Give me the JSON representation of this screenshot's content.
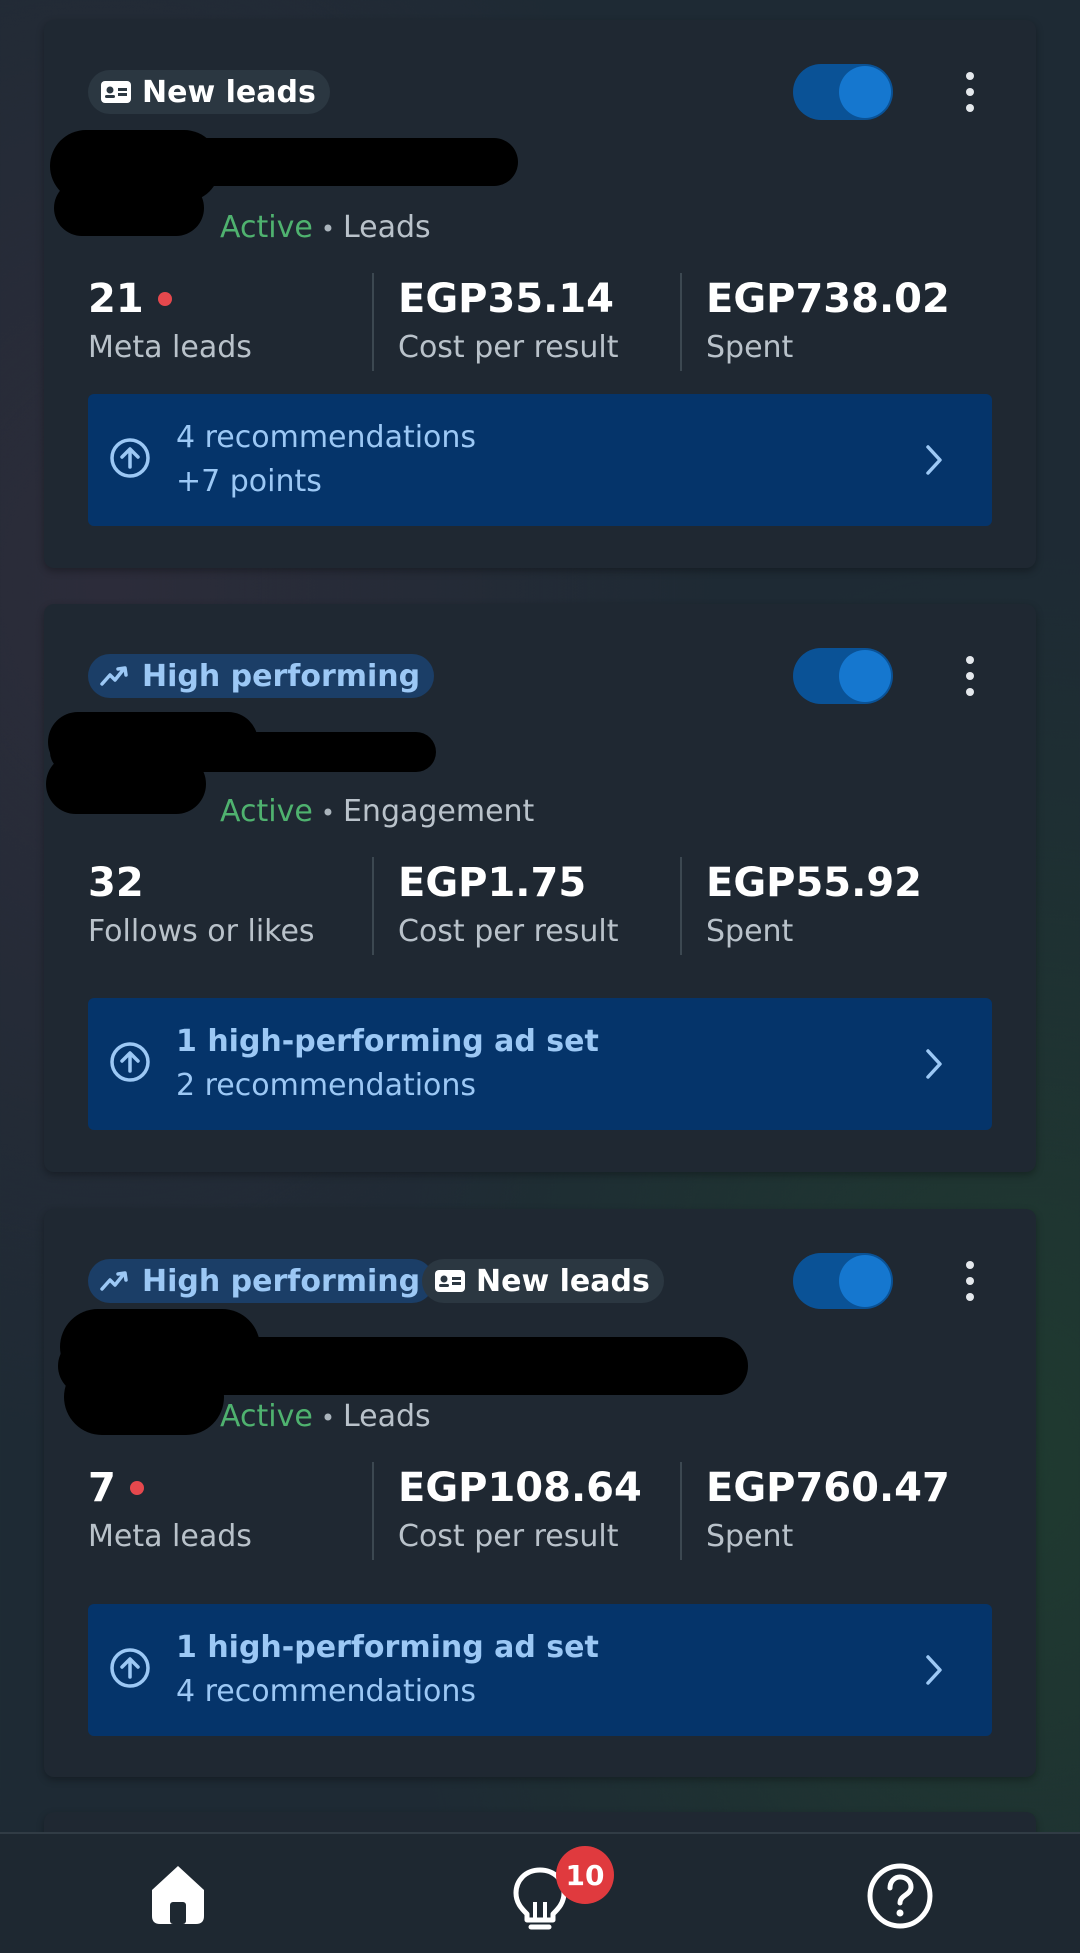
{
  "campaigns": [
    {
      "chips": [
        {
          "type": "leads",
          "label": "New leads"
        }
      ],
      "status": "Active",
      "objective": "Leads",
      "metrics": [
        {
          "value": "21",
          "label": "Meta leads",
          "alert_dot": true
        },
        {
          "value": "EGP35.14",
          "label": "Cost per result"
        },
        {
          "value": "EGP738.02",
          "label": "Spent"
        }
      ],
      "recommendation": {
        "line1": "4 recommendations",
        "line2": "+7 points"
      },
      "toggle_on": true
    },
    {
      "chips": [
        {
          "type": "perf",
          "label": "High performing"
        }
      ],
      "status": "Active",
      "objective": "Engagement",
      "metrics": [
        {
          "value": "32",
          "label": "Follows or likes"
        },
        {
          "value": "EGP1.75",
          "label": "Cost per result"
        },
        {
          "value": "EGP55.92",
          "label": "Spent"
        }
      ],
      "recommendation": {
        "line1": "1 high-performing ad set",
        "line2": "2 recommendations"
      },
      "toggle_on": true
    },
    {
      "chips": [
        {
          "type": "perf",
          "label": "High performing"
        },
        {
          "type": "leads",
          "label": "New leads"
        }
      ],
      "status": "Active",
      "objective": "Leads",
      "metrics": [
        {
          "value": "7",
          "label": "Meta leads",
          "alert_dot": true
        },
        {
          "value": "EGP108.64",
          "label": "Cost per result"
        },
        {
          "value": "EGP760.47",
          "label": "Spent"
        }
      ],
      "recommendation": {
        "line1": "1 high-performing ad set",
        "line2": "4 recommendations"
      },
      "toggle_on": true
    }
  ],
  "nav": {
    "items": [
      {
        "icon": "home-icon"
      },
      {
        "icon": "lightbulb-icon"
      },
      {
        "icon": "help-icon"
      }
    ],
    "notifications_badge": "10"
  },
  "colors": {
    "accent": "#1577cf",
    "active_green": "#4fb26f",
    "recommendation_bg": "#05346a",
    "badge_red": "#e03a3e"
  }
}
